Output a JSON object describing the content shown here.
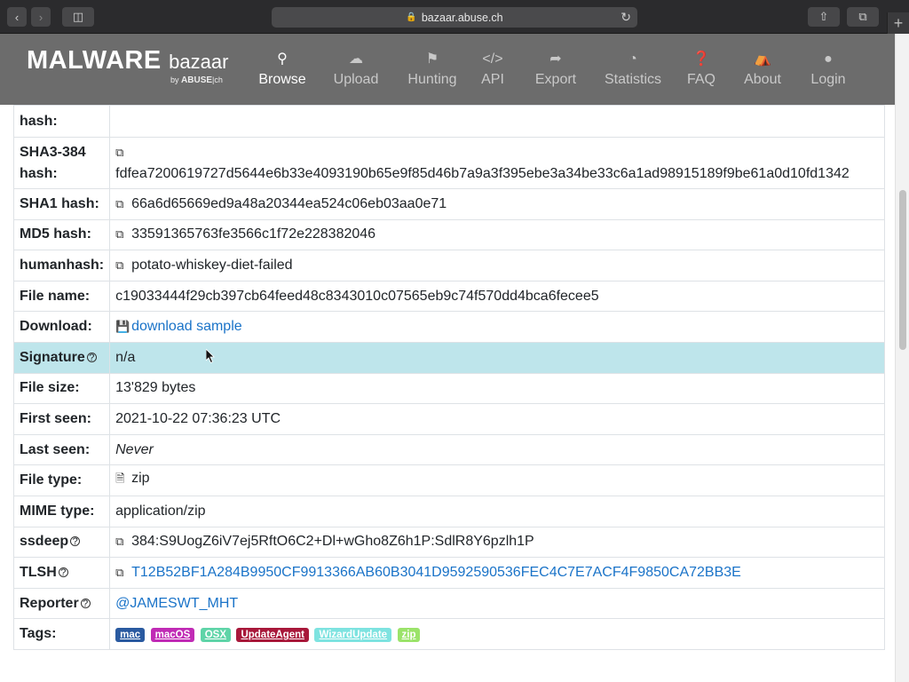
{
  "browser": {
    "url": "bazaar.abuse.ch"
  },
  "header": {
    "logo_main": "MALWARE",
    "logo_sub": "bazaar",
    "logo_by": "by",
    "logo_brand": "ABUSE",
    "logo_tld": "ch",
    "nav": [
      {
        "label": "Browse",
        "icon": "search-icon"
      },
      {
        "label": "Upload",
        "icon": "cloud-upload-icon"
      },
      {
        "label": "Hunting",
        "icon": "hunting-icon"
      },
      {
        "label": "API",
        "icon": "code-icon"
      },
      {
        "label": "Export",
        "icon": "export-icon"
      },
      {
        "label": "Statistics",
        "icon": "pie-chart-icon"
      },
      {
        "label": "FAQ",
        "icon": "question-icon"
      },
      {
        "label": "About",
        "icon": "building-icon"
      },
      {
        "label": "Login",
        "icon": "user-icon"
      }
    ]
  },
  "rows": {
    "sha3_partial_label": "hash:",
    "sha3_384_label": "SHA3-384 hash:",
    "sha3_384_value": "fdfea7200619727d5644e6b33e4093190b65e9f85d46b7a9a3f395ebe3a34be33c6a1ad98915189f9be61a0d10fd1342",
    "sha1_label": "SHA1 hash:",
    "sha1_value": "66a6d65669ed9a48a20344ea524c06eb03aa0e71",
    "md5_label": "MD5 hash:",
    "md5_value": "33591365763fe3566c1f72e228382046",
    "humanhash_label": "humanhash:",
    "humanhash_value": "potato-whiskey-diet-failed",
    "filename_label": "File name:",
    "filename_value": "c19033444f29cb397cb64feed48c8343010c07565eb9c74f570dd4bca6fecee5",
    "download_label": "Download:",
    "download_value": "download sample",
    "signature_label": "Signature",
    "signature_value": "n/a",
    "filesize_label": "File size:",
    "filesize_value": "13'829 bytes",
    "firstseen_label": "First seen:",
    "firstseen_value": "2021-10-22 07:36:23 UTC",
    "lastseen_label": "Last seen:",
    "lastseen_value": "Never",
    "filetype_label": "File type:",
    "filetype_value": "zip",
    "mime_label": "MIME type:",
    "mime_value": "application/zip",
    "ssdeep_label": "ssdeep",
    "ssdeep_value": "384:S9UogZ6iV7ej5RftO6C2+Dl+wGho8Z6h1P:SdlR8Y6pzlh1P",
    "tlsh_label": "TLSH",
    "tlsh_value": "T12B52BF1A284B9950CF9913366AB60B3041D9592590536FEC4C7E7ACF4F9850CA72BB3E",
    "reporter_label": "Reporter",
    "reporter_value": "@JAMESWT_MHT",
    "tags_label": "Tags:"
  },
  "tags": [
    {
      "label": "mac",
      "color": "#2a5aa0"
    },
    {
      "label": "macOS",
      "color": "#c02bb5"
    },
    {
      "label": "OSX",
      "color": "#5fd4a8"
    },
    {
      "label": "UpdateAgent",
      "color": "#a8183a"
    },
    {
      "label": "WizardUpdate",
      "color": "#7ee3e0"
    },
    {
      "label": "zip",
      "color": "#9be36a"
    }
  ],
  "colors": {
    "header_bg": "#6c6c6c",
    "highlight_row": "#bee5eb",
    "link": "#1a73c8"
  }
}
